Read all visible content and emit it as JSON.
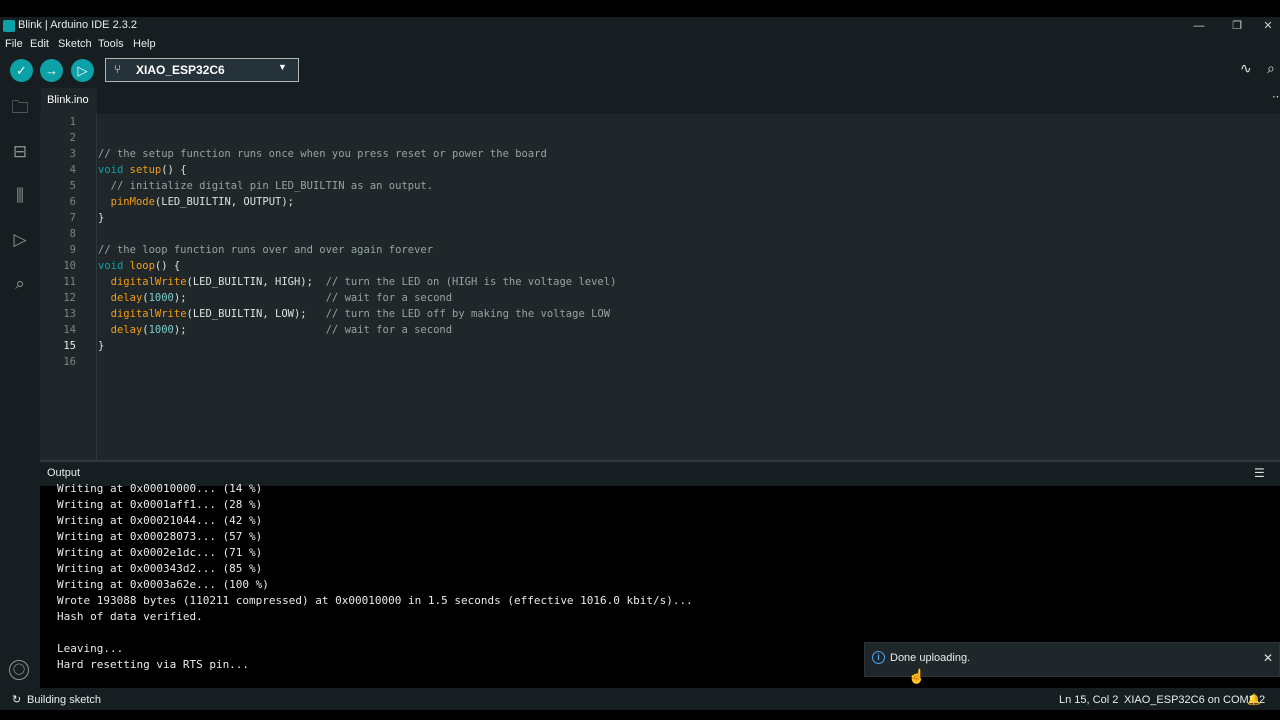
{
  "window": {
    "title": "Blink | Arduino IDE 2.3.2",
    "minimize": "—",
    "restore": "❐",
    "close": "✕"
  },
  "menu": [
    "File",
    "Edit",
    "Sketch",
    "Tools",
    "Help"
  ],
  "toolbar": {
    "verify_icon": "✓",
    "upload_icon": "→",
    "debug_icon": "▷",
    "board": "XIAO_ESP32C6",
    "usb_icon": "⑂",
    "caret": "▼",
    "plotter_icon": "∿",
    "monitor_icon": "⌕"
  },
  "sidebar_icons": {
    "sketchbook": "🗀",
    "boards": "⊟",
    "library": "⫼",
    "debug": "▷",
    "search": "⌕"
  },
  "tab": {
    "label": "Blink.ino",
    "more": "⋯"
  },
  "editor": {
    "line_numbers": [
      "1",
      "2",
      "3",
      "4",
      "5",
      "6",
      "7",
      "8",
      "9",
      "10",
      "11",
      "12",
      "13",
      "14",
      "15",
      "16"
    ],
    "active_line": "15"
  },
  "output": {
    "title": "Output",
    "clear_icon": "☰",
    "lines": [
      "Writing at 0x00010000... (14 %)",
      "Writing at 0x0001aff1... (28 %)",
      "Writing at 0x00021044... (42 %)",
      "Writing at 0x00028073... (57 %)",
      "Writing at 0x0002e1dc... (71 %)",
      "Writing at 0x000343d2... (85 %)",
      "Writing at 0x0003a62e... (100 %)",
      "Wrote 193088 bytes (110211 compressed) at 0x00010000 in 1.5 seconds (effective 1016.0 kbit/s)...",
      "Hash of data verified.",
      "",
      "Leaving...",
      "Hard resetting via RTS pin..."
    ]
  },
  "notification": {
    "icon": "i",
    "text": "Done uploading.",
    "close": "✕"
  },
  "status": {
    "spinner_icon": "↻",
    "left": "Building sketch",
    "position": "Ln 15, Col 2",
    "port": "XIAO_ESP32C6 on COM3",
    "bell_icon": "🔔",
    "count": "2"
  },
  "account_icon": "◯",
  "colors": {
    "accent": "#0ca1a6",
    "background": "#171e21",
    "editor": "#1f272a"
  }
}
